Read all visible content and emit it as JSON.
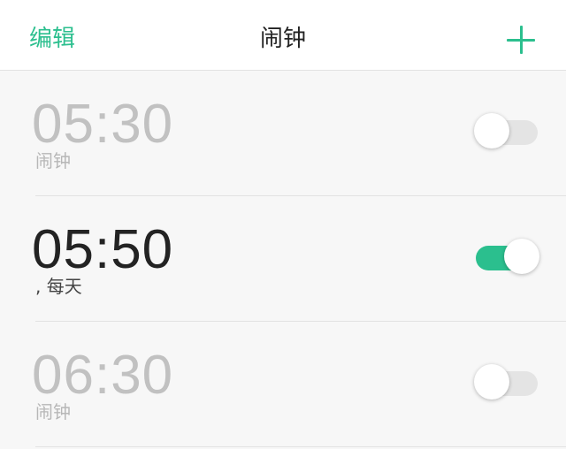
{
  "header": {
    "edit_label": "编辑",
    "title": "闹钟",
    "add_icon": "plus-icon"
  },
  "alarms": [
    {
      "time": "05:30",
      "label": "闹钟",
      "enabled": false
    },
    {
      "time": "05:50",
      "label": ", 每天",
      "enabled": true
    },
    {
      "time": "06:30",
      "label": "闹钟",
      "enabled": false
    }
  ],
  "colors": {
    "accent": "#2bbf8e",
    "active_time": "#232323",
    "inactive_time": "#c1c1c1",
    "background": "#f7f7f7"
  }
}
